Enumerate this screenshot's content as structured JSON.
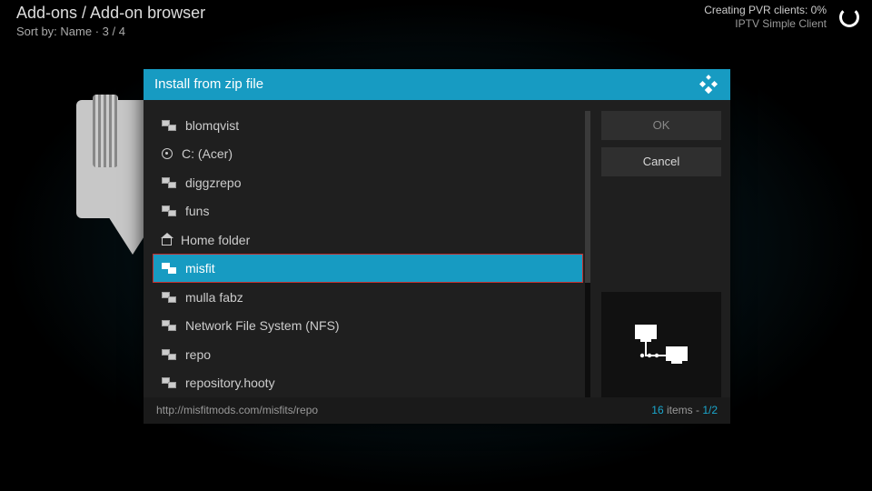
{
  "topbar": {
    "breadcrumb": "Add-ons / Add-on browser",
    "sort_by": "Sort by: Name  ·  3 / 4",
    "status_line1": "Creating PVR clients: 0%",
    "status_line2": "IPTV Simple Client"
  },
  "dialog": {
    "title": "Install from zip file",
    "items": [
      {
        "icon": "net",
        "label": "blomqvist"
      },
      {
        "icon": "disk",
        "label": "C: (Acer)"
      },
      {
        "icon": "net",
        "label": "diggzrepo"
      },
      {
        "icon": "net",
        "label": "funs"
      },
      {
        "icon": "home",
        "label": "Home folder"
      },
      {
        "icon": "net",
        "label": "misfit",
        "selected": true,
        "highlighted": true
      },
      {
        "icon": "net",
        "label": "mulla fabz"
      },
      {
        "icon": "net",
        "label": "Network File System (NFS)"
      },
      {
        "icon": "net",
        "label": "repo"
      },
      {
        "icon": "net",
        "label": "repository.hooty"
      }
    ],
    "ok_label": "OK",
    "cancel_label": "Cancel",
    "footer_path": "http://misfitmods.com/misfits/repo",
    "footer_count": "16",
    "footer_items_word": " items - ",
    "footer_page": "1/2"
  }
}
